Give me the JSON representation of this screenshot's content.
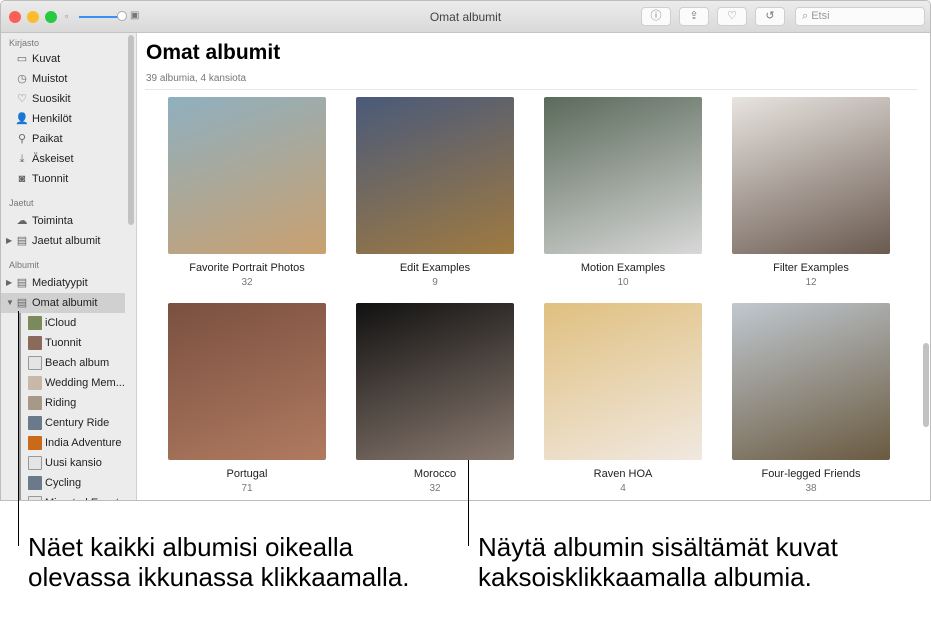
{
  "window": {
    "title": "Omat albumit",
    "search_placeholder": "Etsi",
    "toolbar": [
      {
        "name": "info",
        "glyph": "ⓘ"
      },
      {
        "name": "share",
        "glyph": "⇪"
      },
      {
        "name": "favorite",
        "glyph": "♡"
      },
      {
        "name": "rotate",
        "glyph": "↺"
      }
    ]
  },
  "sidebar": {
    "sections": [
      {
        "title": "Kirjasto",
        "items": [
          {
            "label": "Kuvat",
            "icon": "photos-icon",
            "glyph": "▭"
          },
          {
            "label": "Muistot",
            "icon": "memories-icon",
            "glyph": "◷"
          },
          {
            "label": "Suosikit",
            "icon": "heart-icon",
            "glyph": "♡"
          },
          {
            "label": "Henkilöt",
            "icon": "person-icon",
            "glyph": "👤"
          },
          {
            "label": "Paikat",
            "icon": "pin-icon",
            "glyph": "⚲"
          },
          {
            "label": "Äskeiset",
            "icon": "import-icon",
            "glyph": "⤓"
          },
          {
            "label": "Tuonnit",
            "icon": "camera-icon",
            "glyph": "◙"
          }
        ]
      },
      {
        "title": "Jaetut",
        "items": [
          {
            "label": "Toiminta",
            "icon": "cloud-icon",
            "glyph": "☁"
          },
          {
            "label": "Jaetut albumit",
            "icon": "album-icon",
            "glyph": "▤"
          }
        ]
      },
      {
        "title": "Albumit",
        "items": [
          {
            "label": "Mediatyypit",
            "icon": "album-icon",
            "glyph": "▤"
          },
          {
            "label": "Omat albumit",
            "icon": "album-icon",
            "glyph": "▤"
          }
        ]
      }
    ],
    "subitems": [
      {
        "label": "iCloud",
        "color": "#7a8a5a"
      },
      {
        "label": "Tuonnit",
        "color": "#8a6a5a"
      },
      {
        "label": "Beach album",
        "color": "folder"
      },
      {
        "label": "Wedding Mem...",
        "color": "#c8b8a8"
      },
      {
        "label": "Riding",
        "color": "#a89888"
      },
      {
        "label": "Century Ride",
        "color": "#6a7a8a"
      },
      {
        "label": "India Adventure",
        "color": "#c86a1a"
      },
      {
        "label": "Uusi kansio",
        "color": "folder"
      },
      {
        "label": "Cycling",
        "color": "#6a7a8a"
      },
      {
        "label": "Migrated Events",
        "color": "folder"
      }
    ]
  },
  "main": {
    "title": "Omat albumit",
    "subtitle": "39 albumia, 4 kansiota",
    "albums": [
      {
        "name": "Favorite Portrait Photos",
        "count": "32",
        "colors": [
          "#8fb0c0",
          "#c9a070"
        ]
      },
      {
        "name": "Edit Examples",
        "count": "9",
        "colors": [
          "#4a5a7a",
          "#a07a40"
        ]
      },
      {
        "name": "Motion Examples",
        "count": "10",
        "colors": [
          "#5a6a5a",
          "#d8d8d8"
        ]
      },
      {
        "name": "Filter Examples",
        "count": "12",
        "colors": [
          "#e8e4e0",
          "#6a5a50"
        ]
      },
      {
        "name": "Portugal",
        "count": "71",
        "colors": [
          "#7a5040",
          "#b07a60"
        ]
      },
      {
        "name": "Morocco",
        "count": "32",
        "colors": [
          "#111",
          "#8a7a70"
        ]
      },
      {
        "name": "Raven HOA",
        "count": "4",
        "colors": [
          "#e0c080",
          "#f0e8e0"
        ]
      },
      {
        "name": "Four-legged Friends",
        "count": "38",
        "colors": [
          "#c0c8d0",
          "#6a5a40"
        ]
      }
    ]
  },
  "callouts": [
    "Näet kaikki albumisi oikealla olevassa ikkunassa klikkaamalla.",
    "Näytä albumin sisältämät kuvat kaksoisklikkaamalla albumia."
  ]
}
